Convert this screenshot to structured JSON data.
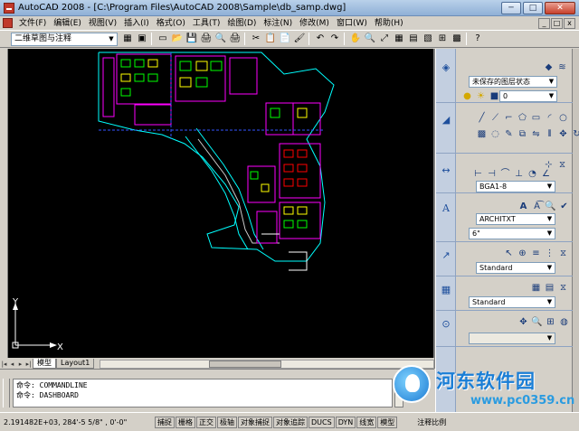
{
  "window": {
    "title": "AutoCAD 2008 - [C:\\Program Files\\AutoCAD 2008\\Sample\\db_samp.dwg]",
    "controls": [
      "─",
      "□",
      "✕"
    ]
  },
  "menu": {
    "items": [
      "文件(F)",
      "编辑(E)",
      "视图(V)",
      "插入(I)",
      "格式(O)",
      "工具(T)",
      "绘图(D)",
      "标注(N)",
      "修改(M)",
      "窗口(W)",
      "帮助(H)"
    ],
    "mdi_controls": [
      "_",
      "□",
      "x"
    ]
  },
  "toolbar": {
    "workspace": "二维草图与注释",
    "icons": [
      "▭",
      "📂",
      "💾",
      "🖨",
      "🔍",
      "🖨",
      "✂",
      "📋",
      "📄",
      "🖌",
      "↶",
      "↷",
      "✋",
      "🔍",
      "⤢",
      "▦",
      "▤",
      "▧",
      "⊞",
      "▩",
      "?"
    ]
  },
  "drawing": {
    "ucs_x": "X",
    "ucs_y": "Y",
    "tabs": [
      "模型",
      "Layout1"
    ]
  },
  "command": {
    "lines": [
      "命令: COMMANDLINE",
      "命令: DASHBOARD"
    ]
  },
  "status": {
    "coords": "2.191482E+03, 284'-5 5/8\" , 0'-0\"",
    "buttons": [
      "捕捉",
      "栅格",
      "正交",
      "极轴",
      "对象捕捉",
      "对象追踪",
      "DUCS",
      "DYN",
      "线宽",
      "模型"
    ],
    "annotation_scale_label": "注释比例"
  },
  "palette": {
    "layer_state": "未保存的图层状态",
    "current_layer": "0",
    "dim_style": "BGA1-8",
    "text_style": "ARCHITXT",
    "text_height": "6\"",
    "mleader_style": "Standard",
    "table_style": "Standard",
    "viewport_blank": ""
  },
  "watermark": {
    "title": "河东软件园",
    "url": "www.pc0359.cn"
  }
}
